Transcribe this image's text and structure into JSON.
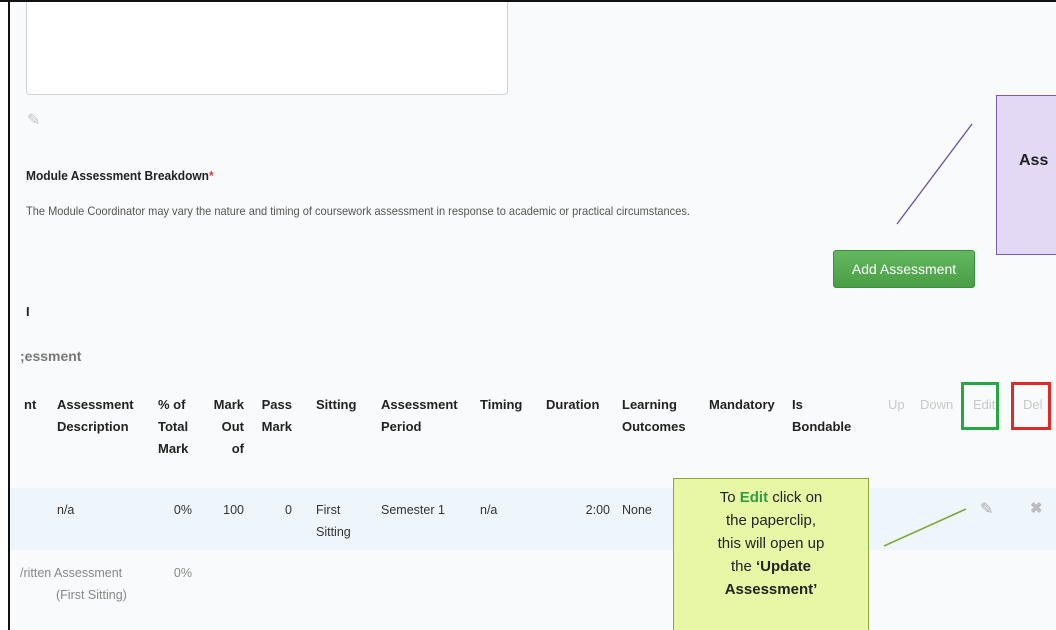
{
  "section": {
    "title": "Module Assessment Breakdown",
    "required_mark": "*",
    "description": "The Module Coordinator may vary the nature and timing of coursework assessment in response to academic or practical circumstances."
  },
  "add_button_label": "Add Assessment",
  "fragments": {
    "heading_fragment": "I",
    "subheading": ";essment"
  },
  "table": {
    "headers": {
      "c0": "nt",
      "description": [
        "Assessment",
        "Description"
      ],
      "percent": [
        "% of",
        "Total",
        "Mark"
      ],
      "mark_out": [
        "Mark",
        "Out",
        "of"
      ],
      "pass_mark": [
        "Pass",
        "Mark"
      ],
      "sitting": "Sitting",
      "period": [
        "Assessment",
        "Period"
      ],
      "timing": "Timing",
      "duration": "Duration",
      "outcomes": [
        "Learning",
        "Outcomes"
      ],
      "mandatory": "Mandatory",
      "bondable": [
        "Is",
        "Bondable"
      ],
      "up": "Up",
      "down": "Down",
      "edit": "Edit",
      "del": "Del"
    },
    "row": {
      "description": "n/a",
      "percent": "0%",
      "mark_out": "100",
      "pass_mark": "0",
      "sitting": [
        "First",
        "Sitting"
      ],
      "period": "Semester 1",
      "timing": "n/a",
      "duration": "2:00",
      "outcomes": "None"
    },
    "subtotal": {
      "label": [
        "/ritten Assessment",
        "(First Sitting)"
      ],
      "percent": "0%"
    }
  },
  "callouts": {
    "purple_text": "Ass",
    "green": {
      "l1_pre": "To ",
      "l1_edit": "Edit",
      "l1_post": " click on",
      "l2": "the paperclip,",
      "l3": "this will open up",
      "l4": "the ",
      "l4_bold": "‘Update",
      "l5": "Assessment’"
    }
  },
  "colors": {
    "add_button": "#4fa84b",
    "edit_highlight": "#27a744",
    "del_highlight": "#e02a2a",
    "purple_callout": "#e3d9f5",
    "green_callout": "#e8f7a6"
  },
  "icons": {
    "pencil": "✎",
    "close": "✖"
  }
}
